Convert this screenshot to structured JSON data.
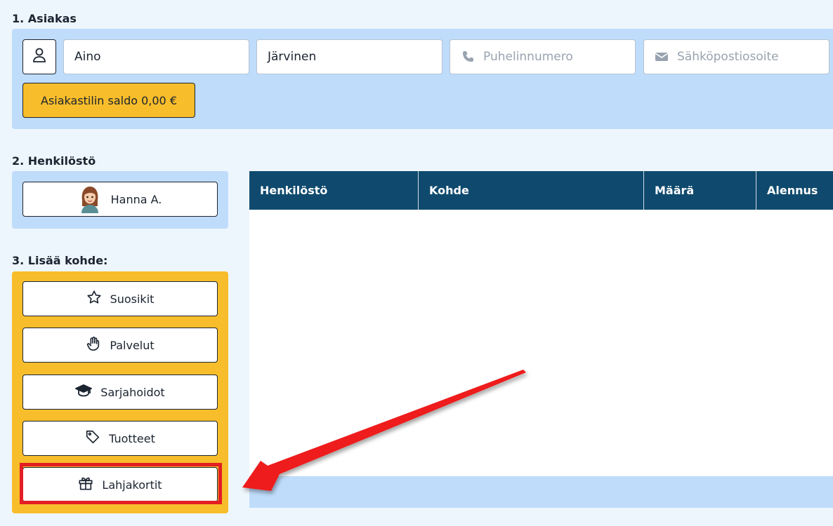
{
  "sections": {
    "customer_title": "1. Asiakas",
    "staff_title": "2. Henkilöstö",
    "add_item_title": "3. Lisää kohde:"
  },
  "customer": {
    "first_name": "Aino",
    "last_name": "Järvinen",
    "phone_placeholder": "Puhelinnumero",
    "email_placeholder": "Sähköpostiosoite",
    "balance_label": "Asiakastilin saldo 0,00 €"
  },
  "staff": {
    "selected_name": "Hanna A."
  },
  "add_item": {
    "buttons": [
      {
        "label": "Suosikit",
        "icon": "star-icon"
      },
      {
        "label": "Palvelut",
        "icon": "hand-icon"
      },
      {
        "label": "Sarjahoidot",
        "icon": "graduation-cap-icon"
      },
      {
        "label": "Tuotteet",
        "icon": "tag-icon"
      },
      {
        "label": "Lahjakortit",
        "icon": "gift-icon"
      }
    ]
  },
  "table": {
    "columns": [
      "Henkilöstö",
      "Kohde",
      "Määrä",
      "Alennus"
    ]
  },
  "colors": {
    "panel_blue": "#bfdcfb",
    "accent_yellow": "#f8bd2a",
    "header_navy": "#0f4a6e",
    "highlight_red": "#e31e24"
  }
}
